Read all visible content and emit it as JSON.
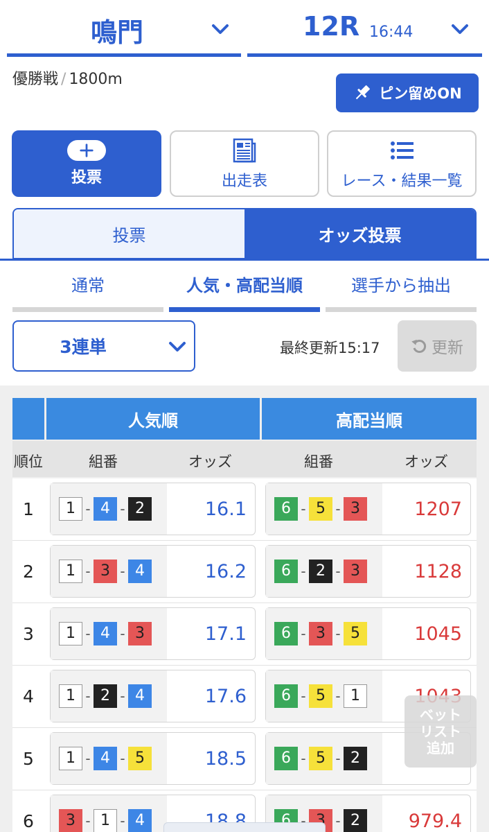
{
  "header": {
    "place": "鳴門",
    "race_number": "12R",
    "race_time": "16:44"
  },
  "race_info": {
    "grade": "優勝戦",
    "separator": "/",
    "distance": "1800m"
  },
  "pin_button": {
    "label": "ピン留めON"
  },
  "nav": {
    "vote": "投票",
    "entry": "出走表",
    "results": "レース・結果一覧"
  },
  "mode_tabs": {
    "vote": "投票",
    "odds_vote": "オッズ投票"
  },
  "sort_tabs": {
    "normal": "通常",
    "popular": "人気・高配当順",
    "pick": "選手から抽出"
  },
  "bet_type": {
    "selected": "3連単"
  },
  "last_updated": "最終更新15:17",
  "refresh_label": "更新",
  "table": {
    "header_popular": "人気順",
    "header_high": "高配当順",
    "col_rank": "順位",
    "col_combo": "組番",
    "col_odds": "オッズ",
    "rows": [
      {
        "rank": "1",
        "pop": {
          "b": [
            "1",
            "4",
            "2"
          ],
          "odds": "16.1"
        },
        "high": {
          "b": [
            "6",
            "5",
            "3"
          ],
          "odds": "1207"
        }
      },
      {
        "rank": "2",
        "pop": {
          "b": [
            "1",
            "3",
            "4"
          ],
          "odds": "16.2"
        },
        "high": {
          "b": [
            "6",
            "2",
            "3"
          ],
          "odds": "1128"
        }
      },
      {
        "rank": "3",
        "pop": {
          "b": [
            "1",
            "4",
            "3"
          ],
          "odds": "17.1"
        },
        "high": {
          "b": [
            "6",
            "3",
            "5"
          ],
          "odds": "1045"
        }
      },
      {
        "rank": "4",
        "pop": {
          "b": [
            "1",
            "2",
            "4"
          ],
          "odds": "17.6"
        },
        "high": {
          "b": [
            "6",
            "5",
            "1"
          ],
          "odds": "1043"
        }
      },
      {
        "rank": "5",
        "pop": {
          "b": [
            "1",
            "4",
            "5"
          ],
          "odds": "18.5"
        },
        "high": {
          "b": [
            "6",
            "5",
            "2"
          ],
          "odds": ""
        }
      },
      {
        "rank": "6",
        "pop": {
          "b": [
            "3",
            "1",
            "4"
          ],
          "odds": "18.8"
        },
        "high": {
          "b": [
            "6",
            "3",
            "2"
          ],
          "odds": "979.4"
        }
      }
    ]
  },
  "floating": {
    "betlist": "ベット\nリスト\n追加"
  },
  "colors": {
    "brand_blue": "#2e5fcf",
    "header_blue": "#3a8ae0",
    "odds_red": "#d93a3a"
  }
}
